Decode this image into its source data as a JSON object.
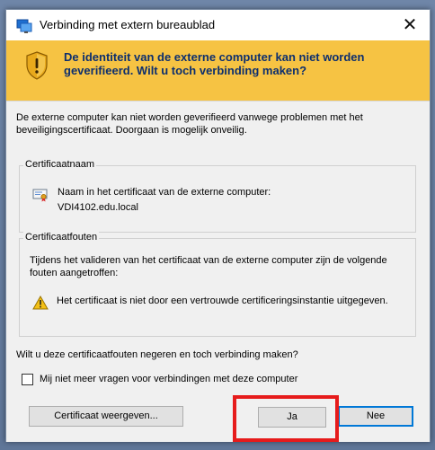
{
  "window": {
    "title": "Verbinding met extern bureaublad",
    "close_label": "✕"
  },
  "banner": {
    "message": "De identiteit van de externe computer kan niet worden geverifieerd. Wilt u toch verbinding maken?",
    "color": "#f6c343",
    "text_color": "#0d2f6e"
  },
  "content": {
    "intro": "De externe computer kan niet worden geverifieerd vanwege problemen met het beveiligingscertificaat. Doorgaan is mogelijk onveilig.",
    "certificate_name": {
      "group_title": "Certificaatnaam",
      "label": "Naam in het certificaat van de externe computer:",
      "value": "VDI4102.edu.local"
    },
    "certificate_errors": {
      "group_title": "Certificaatfouten",
      "intro": "Tijdens het valideren van het certificaat van de externe computer zijn de volgende fouten aangetroffen:",
      "items": [
        "Het certificaat is niet door een vertrouwde certificeringsinstantie uitgegeven."
      ]
    },
    "question": "Wilt u deze certificaatfouten negeren en toch verbinding maken?",
    "checkbox": {
      "label": "Mij niet meer vragen voor verbindingen met deze computer",
      "checked": false
    }
  },
  "buttons": {
    "view_certificate": "Certificaat weergeven...",
    "yes": "Ja",
    "no": "Nee"
  },
  "highlight_color": "#e61b1b"
}
